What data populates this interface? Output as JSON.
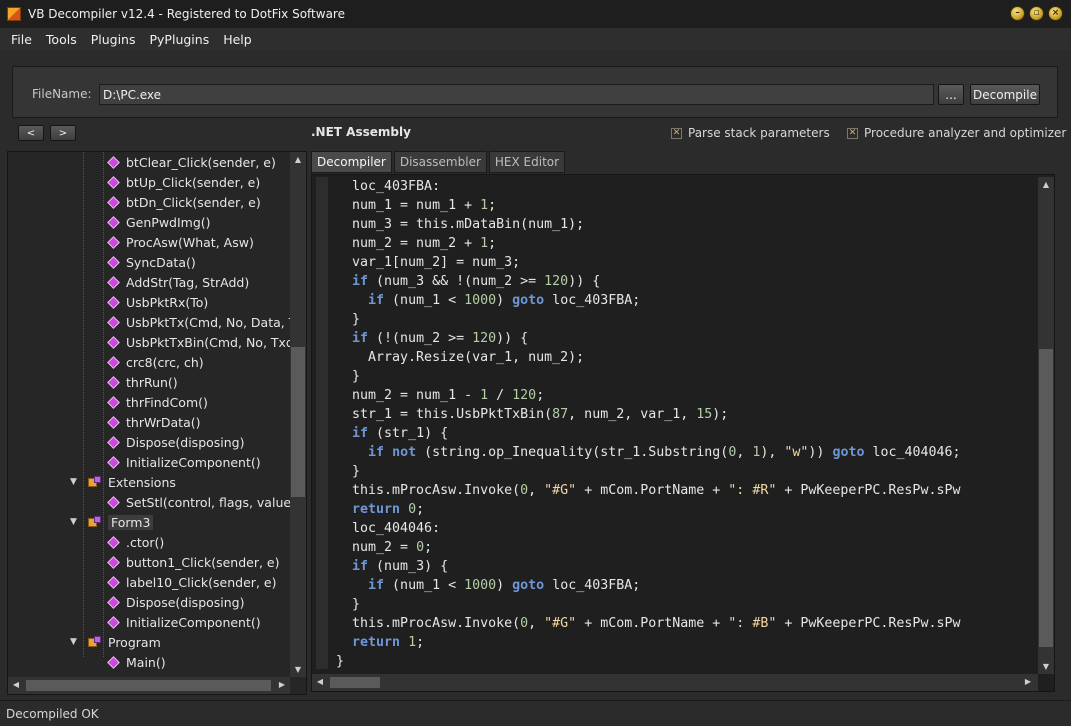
{
  "window": {
    "title": "VB Decompiler v12.4 - Registered to DotFix Software"
  },
  "menu": [
    "File",
    "Tools",
    "Plugins",
    "PyPlugins",
    "Help"
  ],
  "file": {
    "label": "FileName:",
    "value": "D:\\PC.exe",
    "browse_label": "...",
    "decompile_label": "Decompile"
  },
  "nav": {
    "back_label": "<",
    "forward_label": ">",
    "assembly_label": ".NET Assembly"
  },
  "options": [
    {
      "label": "Parse stack parameters",
      "checked": true
    },
    {
      "label": "Procedure analyzer and optimizer",
      "checked": true
    }
  ],
  "tree": [
    {
      "label": "btClear_Click(sender, e)",
      "type": "method",
      "level": 2
    },
    {
      "label": "btUp_Click(sender, e)",
      "type": "method",
      "level": 2
    },
    {
      "label": "btDn_Click(sender, e)",
      "type": "method",
      "level": 2
    },
    {
      "label": "GenPwdImg()",
      "type": "method",
      "level": 2
    },
    {
      "label": "ProcAsw(What, Asw)",
      "type": "method",
      "level": 2
    },
    {
      "label": "SyncData()",
      "type": "method",
      "level": 2
    },
    {
      "label": "AddStr(Tag, StrAdd)",
      "type": "method",
      "level": 2
    },
    {
      "label": "UsbPktRx(To)",
      "type": "method",
      "level": 2
    },
    {
      "label": "UsbPktTx(Cmd, No, Data, To",
      "type": "method",
      "level": 2
    },
    {
      "label": "UsbPktTxBin(Cmd, No, Txd, T",
      "type": "method",
      "level": 2
    },
    {
      "label": "crc8(crc, ch)",
      "type": "method",
      "level": 2
    },
    {
      "label": "thrRun()",
      "type": "method",
      "level": 2
    },
    {
      "label": "thrFindCom()",
      "type": "method",
      "level": 2
    },
    {
      "label": "thrWrData()",
      "type": "method",
      "level": 2
    },
    {
      "label": "Dispose(disposing)",
      "type": "method",
      "level": 2
    },
    {
      "label": "InitializeComponent()",
      "type": "method",
      "level": 2
    },
    {
      "label": "Extensions",
      "type": "class",
      "level": 1
    },
    {
      "label": "SetStl(control, flags, value)",
      "type": "method",
      "level": 2
    },
    {
      "label": "Form3",
      "type": "class",
      "level": 1,
      "selected": true
    },
    {
      "label": ".ctor()",
      "type": "method",
      "level": 2
    },
    {
      "label": "button1_Click(sender, e)",
      "type": "method",
      "level": 2
    },
    {
      "label": "label10_Click(sender, e)",
      "type": "method",
      "level": 2
    },
    {
      "label": "Dispose(disposing)",
      "type": "method",
      "level": 2
    },
    {
      "label": "InitializeComponent()",
      "type": "method",
      "level": 2
    },
    {
      "label": "Program",
      "type": "class",
      "level": 1
    },
    {
      "label": "Main()",
      "type": "method",
      "level": 2
    }
  ],
  "tabs": [
    {
      "label": "Decompiler",
      "active": true
    },
    {
      "label": "Disassembler",
      "active": false
    },
    {
      "label": "HEX Editor",
      "active": false
    }
  ],
  "code": [
    "  loc_403FBA:",
    "  num_1 = num_1 + 1;",
    "  num_3 = this.mDataBin(num_1);",
    "  num_2 = num_2 + 1;",
    "  var_1[num_2] = num_3;",
    "  if (num_3 && !(num_2 >= 120)) {",
    "    if (num_1 < 1000) goto loc_403FBA;",
    "  }",
    "  if (!(num_2 >= 120)) {",
    "    Array.Resize(var_1, num_2);",
    "  }",
    "  num_2 = num_1 - 1 / 120;",
    "  str_1 = this.UsbPktTxBin(87, num_2, var_1, 15);",
    "  if (str_1) {",
    "    if not (string.op_Inequality(str_1.Substring(0, 1), \"w\")) goto loc_404046;",
    "  }",
    "  this.mProcAsw.Invoke(0, \"#G\" + mCom.PortName + \": #R\" + PwKeeperPC.ResPw.sPw",
    "  return 0;",
    "  loc_404046:",
    "  num_2 = 0;",
    "  if (num_3) {",
    "    if (num_1 < 1000) goto loc_403FBA;",
    "  }",
    "  this.mProcAsw.Invoke(0, \"#G\" + mCom.PortName + \": #B\" + PwKeeperPC.ResPw.sPw",
    "  return 1;",
    "}"
  ],
  "status": {
    "text": "Decompiled OK"
  },
  "colors": {
    "keyword": "#6f97d6",
    "string": "#f3d7a2",
    "number": "#b5cea8",
    "background": "#1f1f1f"
  }
}
